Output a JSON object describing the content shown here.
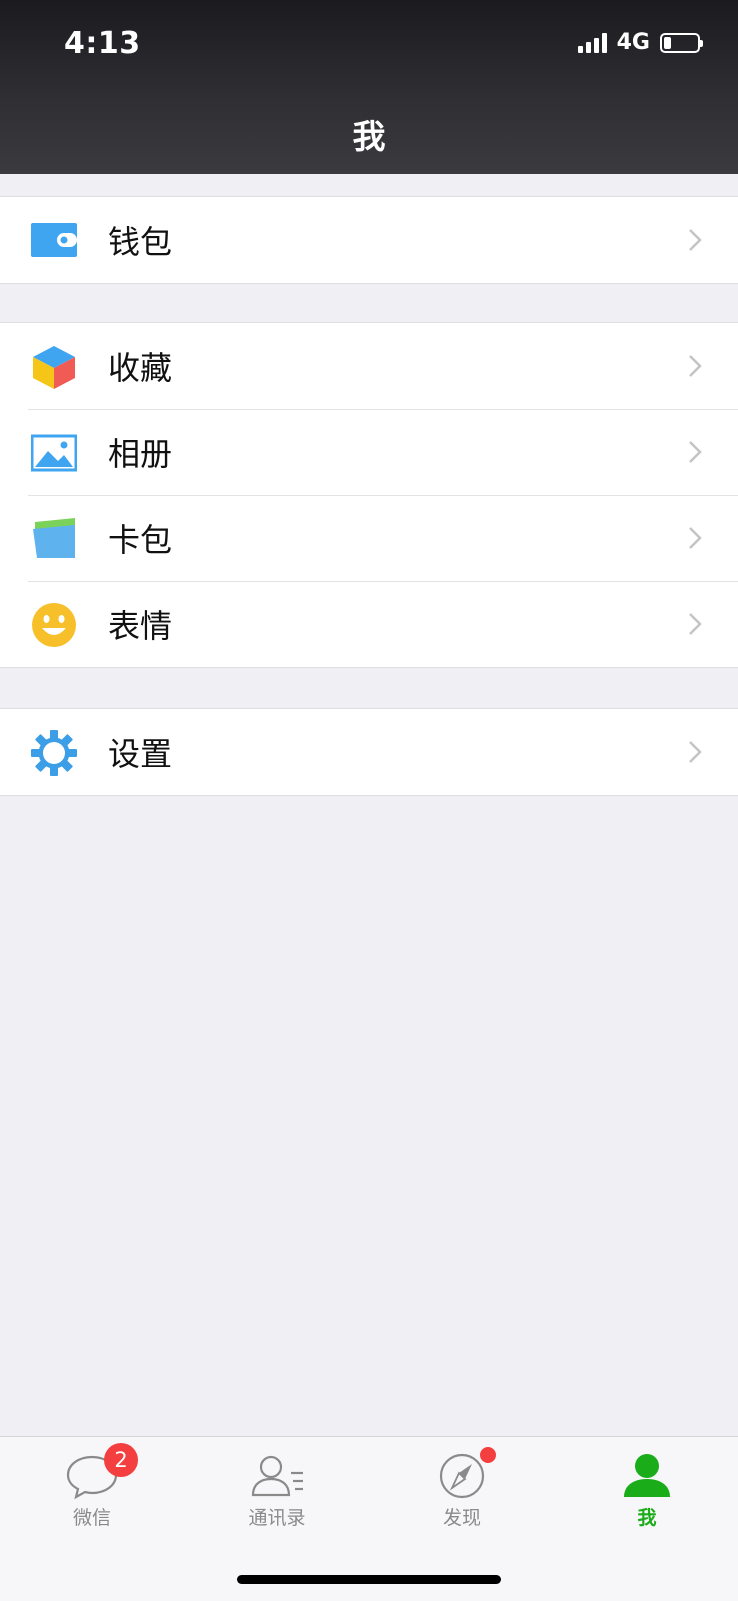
{
  "status_bar": {
    "time": "4:13",
    "network": "4G",
    "battery_level": 0.22
  },
  "header": {
    "title": "我"
  },
  "menu_groups": [
    {
      "items": [
        {
          "label": "钱包",
          "icon": "wallet-icon"
        }
      ]
    },
    {
      "items": [
        {
          "label": "收藏",
          "icon": "favorites-cube-icon"
        },
        {
          "label": "相册",
          "icon": "album-picture-icon"
        },
        {
          "label": "卡包",
          "icon": "card-case-icon"
        },
        {
          "label": "表情",
          "icon": "smiley-icon"
        }
      ]
    },
    {
      "items": [
        {
          "label": "设置",
          "icon": "gear-icon"
        }
      ]
    }
  ],
  "tab_bar": {
    "tabs": [
      {
        "label": "微信",
        "icon": "chat-bubble-icon",
        "badge": "2"
      },
      {
        "label": "通讯录",
        "icon": "contacts-icon"
      },
      {
        "label": "发现",
        "icon": "compass-icon",
        "dot": true
      },
      {
        "label": "我",
        "icon": "person-icon",
        "active": true
      }
    ]
  },
  "colors": {
    "accent_active": "#1aad19",
    "badge_red": "#f33f3f",
    "icon_blue": "#3d9ee8"
  }
}
